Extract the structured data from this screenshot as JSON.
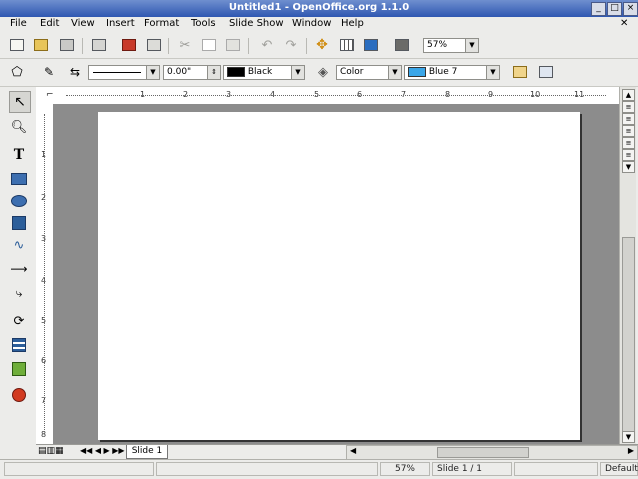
{
  "window": {
    "title": "Untitled1 - OpenOffice.org 1.1.0"
  },
  "menu": [
    "File",
    "Edit",
    "View",
    "Insert",
    "Format",
    "Tools",
    "Slide Show",
    "Window",
    "Help"
  ],
  "menu_close": "✕",
  "toolbar": {
    "zoom": "57%"
  },
  "objectbar": {
    "line_width": "0.00\"",
    "line_color": "Black",
    "line_color_swatch": "#000000",
    "area_style": "Color",
    "area_color": "Blue 7",
    "area_color_swatch": "#3aa6e8"
  },
  "ruler": {
    "h": [
      "1",
      "2",
      "3",
      "4",
      "5",
      "6",
      "7",
      "8",
      "9",
      "10",
      "11"
    ],
    "v": [
      "1",
      "2",
      "3",
      "4",
      "5",
      "6",
      "7",
      "8"
    ]
  },
  "tabs": {
    "slide_tab": "Slide 1"
  },
  "status": {
    "zoom": "57%",
    "slide": "Slide 1 / 1",
    "layout": "Default"
  }
}
